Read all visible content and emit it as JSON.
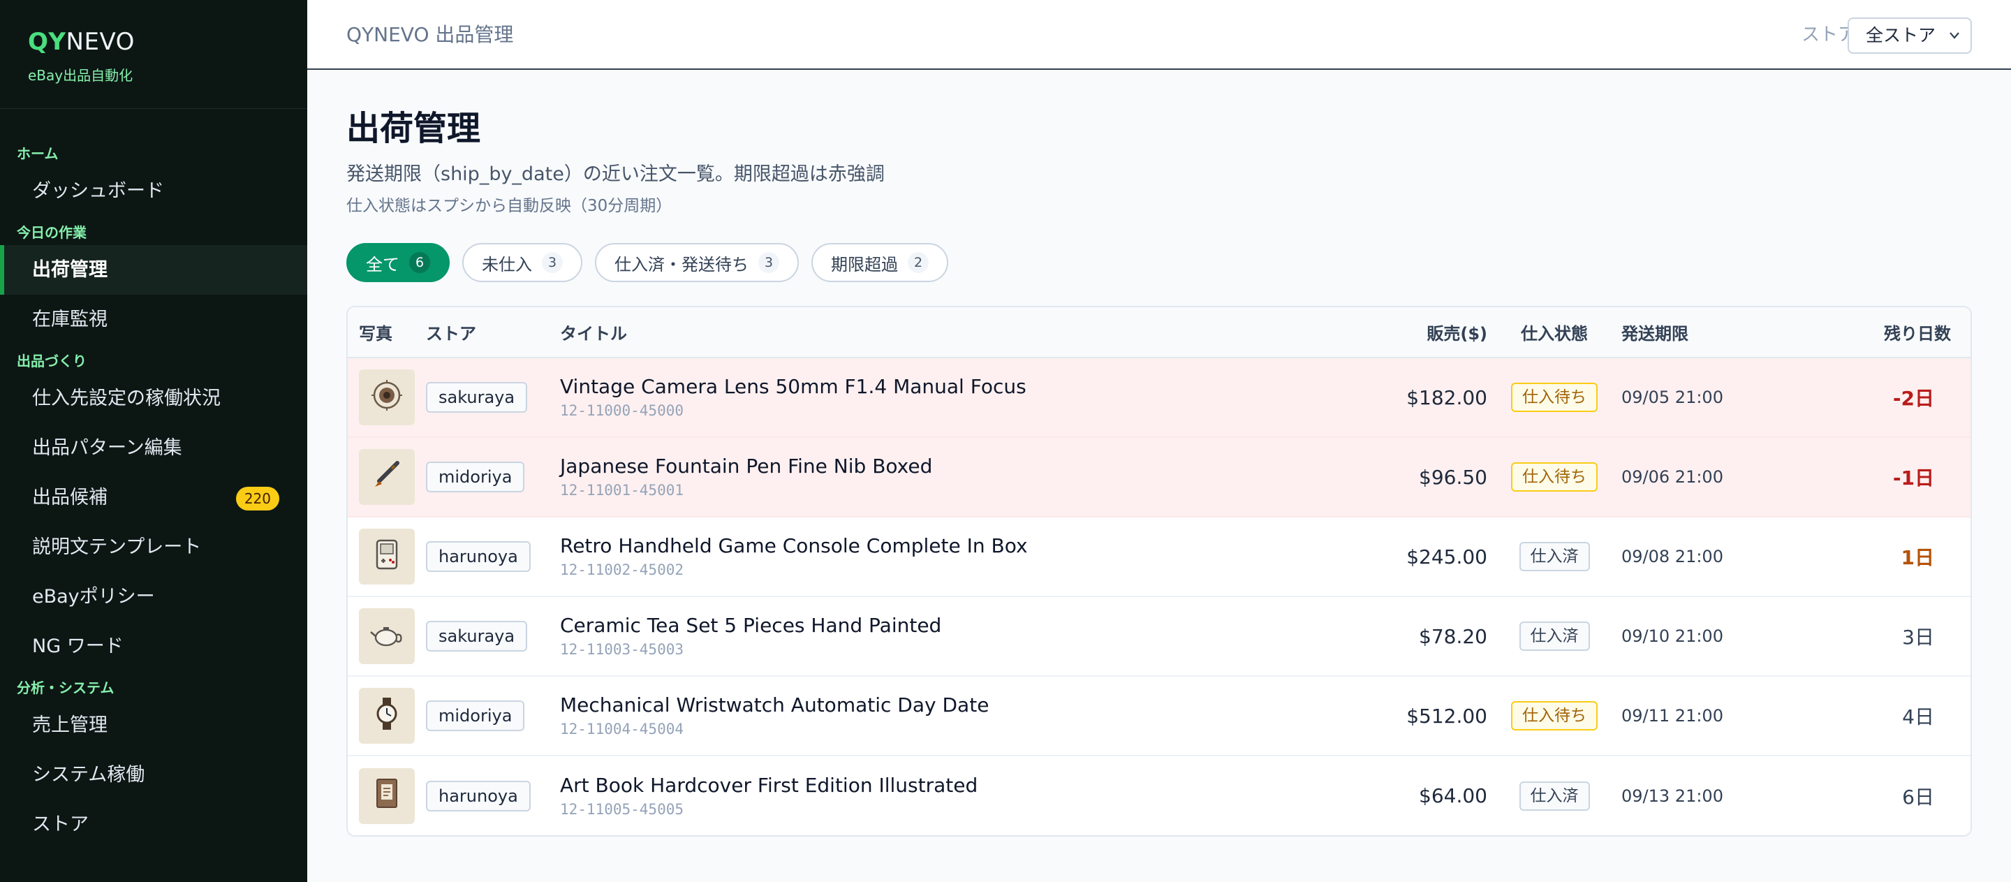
{
  "brand": {
    "logo_accent": "QY",
    "logo_rest": "NEVO",
    "subtitle": "eBay出品自動化"
  },
  "sidebar": {
    "sections": [
      {
        "label": "ホーム",
        "items": [
          {
            "label": "ダッシュボード"
          }
        ]
      },
      {
        "label": "今日の作業",
        "items": [
          {
            "label": "出荷管理",
            "active": true
          },
          {
            "label": "在庫監視"
          }
        ]
      },
      {
        "label": "出品づくり",
        "items": [
          {
            "label": "仕入先設定の稼働状況"
          },
          {
            "label": "出品パターン編集"
          },
          {
            "label": "出品候補",
            "badge": "220"
          },
          {
            "label": "説明文テンプレート"
          },
          {
            "label": "eBayポリシー"
          },
          {
            "label": "NG ワード"
          }
        ]
      },
      {
        "label": "分析・システム",
        "items": [
          {
            "label": "売上管理"
          },
          {
            "label": "システム稼働"
          },
          {
            "label": "ストア"
          }
        ]
      }
    ]
  },
  "header": {
    "title": "QYNEVO 出品管理",
    "store_label": "ストア",
    "store_value": "全ストア"
  },
  "page": {
    "title": "出荷管理",
    "description": "発送期限（ship_by_date）の近い注文一覧。期限超過は赤強調",
    "note": "仕入状態はスプシから自動反映（30分周期）"
  },
  "filters": [
    {
      "label": "全て",
      "count": "6",
      "active": true
    },
    {
      "label": "未仕入",
      "count": "3"
    },
    {
      "label": "仕入済・発送待ち",
      "count": "3"
    },
    {
      "label": "期限超過",
      "count": "2"
    }
  ],
  "table": {
    "headers": {
      "photo": "写真",
      "store": "ストア",
      "title": "タイトル",
      "price": "販売($)",
      "status": "仕入状態",
      "due": "発送期限",
      "remaining": "残り日数"
    },
    "rows": [
      {
        "icon": "camera-lens-icon",
        "store": "sakuraya",
        "title": "Vintage Camera Lens 50mm F1.4 Manual Focus",
        "order_id": "12-11000-45000",
        "price": "$182.00",
        "status": "仕入待ち",
        "status_type": "wait",
        "due": "09/05 21:00",
        "remaining": "-2日",
        "remaining_type": "neg",
        "overdue": true
      },
      {
        "icon": "fountain-pen-icon",
        "store": "midoriya",
        "title": "Japanese Fountain Pen Fine Nib Boxed",
        "order_id": "12-11001-45001",
        "price": "$96.50",
        "status": "仕入待ち",
        "status_type": "wait",
        "due": "09/06 21:00",
        "remaining": "-1日",
        "remaining_type": "neg",
        "overdue": true
      },
      {
        "icon": "game-console-icon",
        "store": "harunoya",
        "title": "Retro Handheld Game Console Complete In Box",
        "order_id": "12-11002-45002",
        "price": "$245.00",
        "status": "仕入済",
        "status_type": "done",
        "due": "09/08 21:00",
        "remaining": "1日",
        "remaining_type": "soon",
        "overdue": false
      },
      {
        "icon": "teapot-icon",
        "store": "sakuraya",
        "title": "Ceramic Tea Set 5 Pieces Hand Painted",
        "order_id": "12-11003-45003",
        "price": "$78.20",
        "status": "仕入済",
        "status_type": "done",
        "due": "09/10 21:00",
        "remaining": "3日",
        "remaining_type": "ok",
        "overdue": false
      },
      {
        "icon": "wristwatch-icon",
        "store": "midoriya",
        "title": "Mechanical Wristwatch Automatic Day Date",
        "order_id": "12-11004-45004",
        "price": "$512.00",
        "status": "仕入待ち",
        "status_type": "wait",
        "due": "09/11 21:00",
        "remaining": "4日",
        "remaining_type": "ok",
        "overdue": false
      },
      {
        "icon": "book-icon",
        "store": "harunoya",
        "title": "Art Book Hardcover First Edition Illustrated",
        "order_id": "12-11005-45005",
        "price": "$64.00",
        "status": "仕入済",
        "status_type": "done",
        "due": "09/13 21:00",
        "remaining": "6日",
        "remaining_type": "ok",
        "overdue": false
      }
    ]
  }
}
